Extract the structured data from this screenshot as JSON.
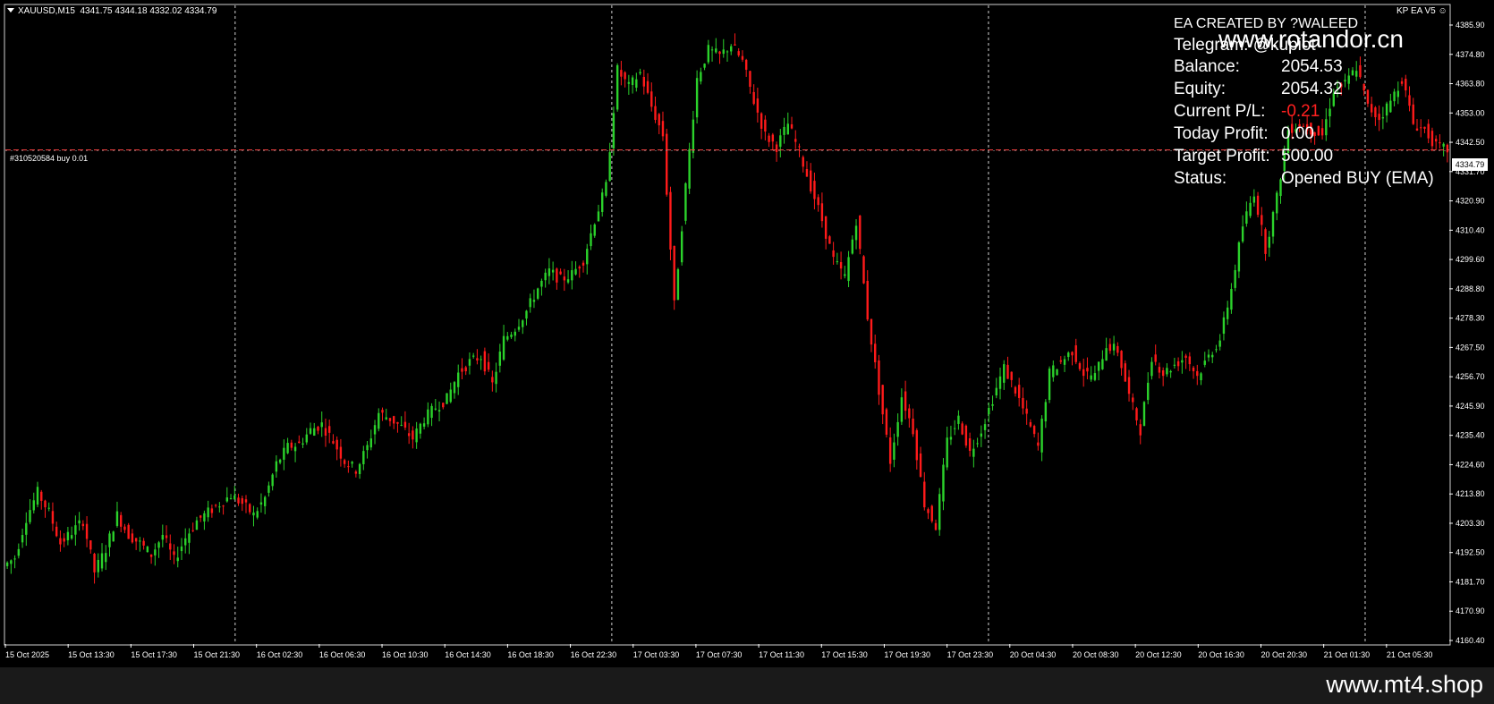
{
  "symbol_info": {
    "symbol": "XAUUSD,M15",
    "ohlc": "4341.75 4344.18 4332.02 4334.79"
  },
  "ea_badge": "KP EA V5",
  "order_line": {
    "label": "#310520584 buy 0.01",
    "price_tag": "4334.79"
  },
  "ea_panel": {
    "created_by": "EA CREATED BY ?WALEED",
    "telegram_label": "Telegram: @kupiot",
    "rows": [
      {
        "label": "Balance:",
        "value": "2054.53"
      },
      {
        "label": "Equity:",
        "value": "2054.32"
      },
      {
        "label": "Current P/L:",
        "value": "-0.21"
      },
      {
        "label": "Today Profit:",
        "value": "0.00"
      },
      {
        "label": "Target Profit:",
        "value": "500.00"
      },
      {
        "label": "Status:",
        "value": "Opened BUY (EMA)"
      }
    ],
    "negative_color": "#ff2020"
  },
  "watermarks": {
    "top": "www.rotandor.cn",
    "bottom": "www.mt4.shop"
  },
  "colors": {
    "bull": "#2bd22b",
    "bear": "#ff1a1a",
    "axis": "#ffffff",
    "order_line": "#ff4444"
  },
  "chart_data": {
    "type": "candlestick",
    "title": "",
    "price_axis": {
      "ylim": [
        4160.48,
        4385.8
      ],
      "ticks": [
        "4385.90",
        "4374.80",
        "4363.80",
        "4353.00",
        "4342.50",
        "4331.70",
        "4320.90",
        "4310.40",
        "4299.60",
        "4288.80",
        "4278.30",
        "4267.50",
        "4256.70",
        "4245.90",
        "4235.40",
        "4224.60",
        "4213.80",
        "4203.30",
        "4192.50",
        "4181.70",
        "4170.90",
        "4160.40"
      ]
    },
    "time_axis": {
      "labels": [
        "15 Oct 2025",
        "15 Oct 13:30",
        "15 Oct 17:30",
        "15 Oct 21:30",
        "16 Oct 02:30",
        "16 Oct 06:30",
        "16 Oct 10:30",
        "16 Oct 14:30",
        "16 Oct 18:30",
        "16 Oct 22:30",
        "17 Oct 03:30",
        "17 Oct 07:30",
        "17 Oct 11:30",
        "17 Oct 15:30",
        "17 Oct 19:30",
        "17 Oct 23:30",
        "20 Oct 04:30",
        "20 Oct 08:30",
        "20 Oct 12:30",
        "20 Oct 16:30",
        "20 Oct 20:30",
        "21 Oct 01:30",
        "21 Oct 05:30"
      ],
      "day_separator_indices": [
        3,
        9,
        15,
        21
      ]
    },
    "current_price": 4334.79,
    "series": [
      {
        "kind": "close",
        "values": [
          4191,
          4205,
          4214,
          4207,
          4196,
          4200,
          4204,
          4186,
          4194,
          4206,
          4199,
          4196,
          4192,
          4199,
          4190,
          4198,
          4204,
          4207,
          4210,
          4213,
          4210,
          4206,
          4212,
          4224,
          4230,
          4231,
          4236,
          4238,
          4232,
          4225,
          4222,
          4230,
          4242,
          4240,
          4237,
          4233,
          4240,
          4244,
          4247,
          4256,
          4260,
          4262,
          4252,
          4268,
          4272,
          4278,
          4286,
          4292,
          4289,
          4291,
          4296,
          4310,
          4322,
          4363,
          4357,
          4362,
          4350,
          4340,
          4280,
          4322,
          4360,
          4370,
          4368,
          4372,
          4366,
          4352,
          4340,
          4336,
          4344,
          4334,
          4322,
          4310,
          4296,
          4290,
          4310,
          4276,
          4250,
          4225,
          4248,
          4236,
          4210,
          4202,
          4232,
          4240,
          4228,
          4236,
          4247,
          4258,
          4250,
          4240,
          4230,
          4256,
          4260,
          4264,
          4256,
          4255,
          4266,
          4264,
          4248,
          4236,
          4262,
          4256,
          4259,
          4262,
          4255,
          4262,
          4268,
          4286,
          4308,
          4320,
          4300,
          4318,
          4342,
          4344,
          4342,
          4340,
          4356,
          4358,
          4364,
          4350,
          4346,
          4352,
          4360,
          4344,
          4342,
          4336,
          4334.79
        ]
      }
    ]
  }
}
